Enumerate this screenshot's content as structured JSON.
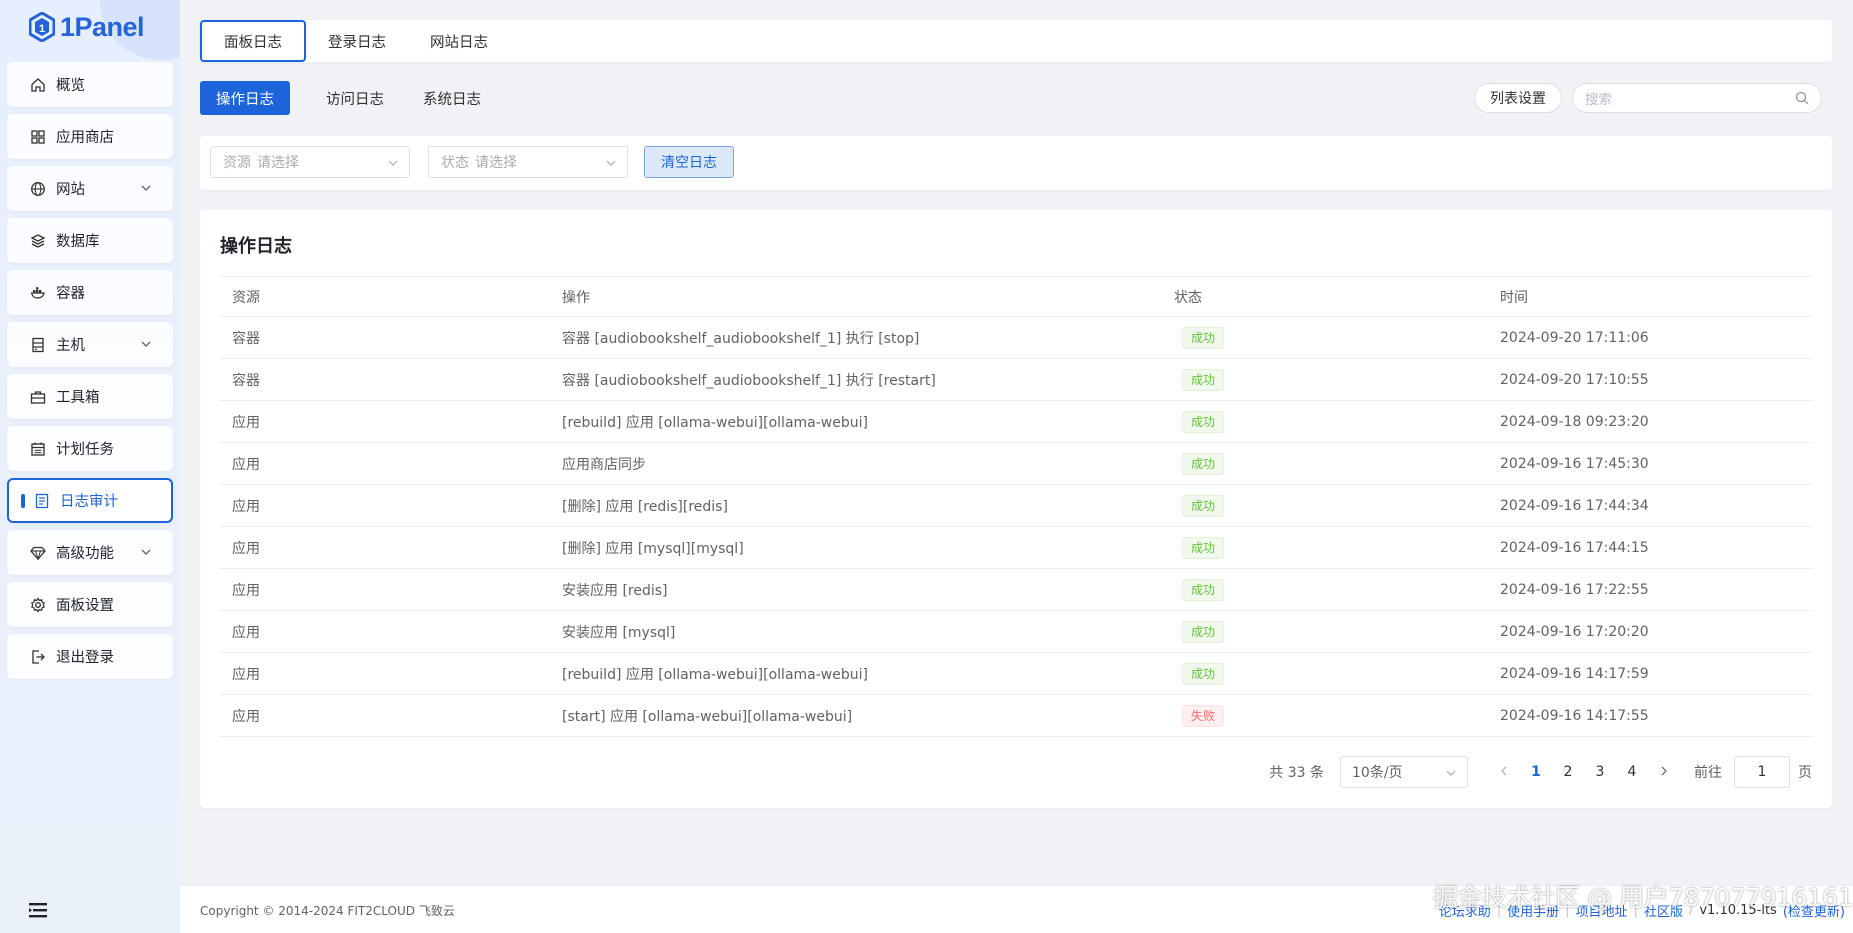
{
  "app": {
    "name": "1Panel"
  },
  "sidebar": {
    "items": [
      {
        "label": "概览",
        "icon": "home-icon"
      },
      {
        "label": "应用商店",
        "icon": "grid-icon"
      },
      {
        "label": "网站",
        "icon": "globe-icon",
        "expandable": true
      },
      {
        "label": "数据库",
        "icon": "layers-icon"
      },
      {
        "label": "容器",
        "icon": "docker-icon"
      },
      {
        "label": "主机",
        "icon": "server-icon",
        "expandable": true
      },
      {
        "label": "工具箱",
        "icon": "toolbox-icon"
      },
      {
        "label": "计划任务",
        "icon": "calendar-icon"
      },
      {
        "label": "日志审计",
        "icon": "log-icon",
        "active": true
      },
      {
        "label": "高级功能",
        "icon": "diamond-icon",
        "expandable": true
      },
      {
        "label": "面板设置",
        "icon": "gear-icon"
      },
      {
        "label": "退出登录",
        "icon": "logout-icon"
      }
    ]
  },
  "topnav": {
    "tabs": [
      "面板日志",
      "登录日志",
      "网站日志"
    ],
    "active": 0
  },
  "subnav": {
    "tabs": [
      "操作日志",
      "访问日志",
      "系统日志"
    ],
    "active": 0
  },
  "toolbar": {
    "columns_label": "列表设置",
    "search_placeholder": "搜索"
  },
  "filters": {
    "resource": {
      "prefix": "资源",
      "placeholder": "请选择"
    },
    "status": {
      "prefix": "状态",
      "placeholder": "请选择"
    },
    "clear_label": "清空日志"
  },
  "table": {
    "title": "操作日志",
    "columns": [
      "资源",
      "操作",
      "状态",
      "时间"
    ],
    "rows": [
      {
        "resource": "容器",
        "action": "容器 [audiobookshelf_audiobookshelf_1] 执行 [stop]",
        "status": "成功",
        "ok": true,
        "time": "2024-09-20 17:11:06"
      },
      {
        "resource": "容器",
        "action": "容器 [audiobookshelf_audiobookshelf_1] 执行 [restart]",
        "status": "成功",
        "ok": true,
        "time": "2024-09-20 17:10:55"
      },
      {
        "resource": "应用",
        "action": "[rebuild] 应用 [ollama-webui][ollama-webui]",
        "status": "成功",
        "ok": true,
        "time": "2024-09-18 09:23:20"
      },
      {
        "resource": "应用",
        "action": "应用商店同步",
        "status": "成功",
        "ok": true,
        "time": "2024-09-16 17:45:30"
      },
      {
        "resource": "应用",
        "action": "[删除] 应用 [redis][redis]",
        "status": "成功",
        "ok": true,
        "time": "2024-09-16 17:44:34"
      },
      {
        "resource": "应用",
        "action": "[删除] 应用 [mysql][mysql]",
        "status": "成功",
        "ok": true,
        "time": "2024-09-16 17:44:15"
      },
      {
        "resource": "应用",
        "action": "安装应用 [redis]",
        "status": "成功",
        "ok": true,
        "time": "2024-09-16 17:22:55"
      },
      {
        "resource": "应用",
        "action": "安装应用 [mysql]",
        "status": "成功",
        "ok": true,
        "time": "2024-09-16 17:20:20"
      },
      {
        "resource": "应用",
        "action": "[rebuild] 应用 [ollama-webui][ollama-webui]",
        "status": "成功",
        "ok": true,
        "time": "2024-09-16 14:17:59"
      },
      {
        "resource": "应用",
        "action": "[start] 应用 [ollama-webui][ollama-webui]",
        "status": "失败",
        "ok": false,
        "time": "2024-09-16 14:17:55"
      }
    ]
  },
  "pagination": {
    "total_label": "共 33 条",
    "page_size": "10条/页",
    "pages": [
      "1",
      "2",
      "3",
      "4"
    ],
    "current": "1",
    "goto_prefix": "前往",
    "goto_value": "1",
    "goto_suffix": "页"
  },
  "footer": {
    "copyright": "Copyright © 2014-2024 FIT2CLOUD 飞致云",
    "links": [
      "论坛求助",
      "使用手册",
      "项目地址",
      "社区版"
    ],
    "version": "v1.10.15-lts",
    "check_update": "(检查更新)"
  },
  "watermark": "掘金技术社区 @ 用户787077916161",
  "colors": {
    "accent": "#1d63d9",
    "success": "#67c23a",
    "danger": "#f56c6c"
  }
}
